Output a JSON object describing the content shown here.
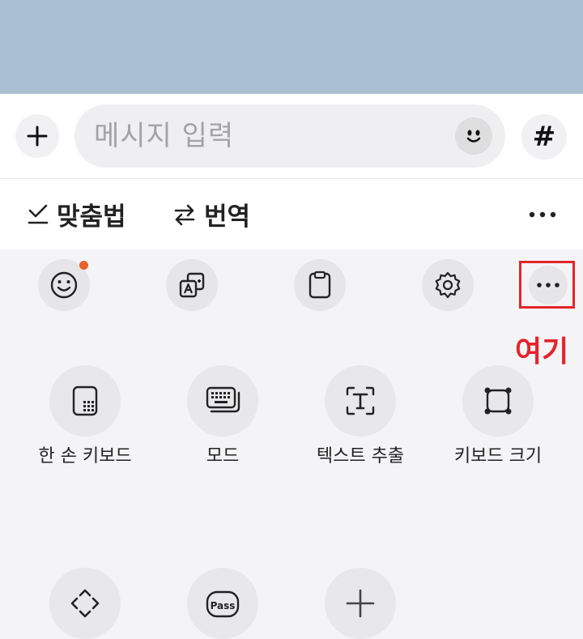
{
  "composer": {
    "placeholder": "메시지 입력",
    "plus_icon": "plus-icon",
    "emoji_icon": "emoji-face-icon",
    "hashtag_label": "#"
  },
  "toolbar": {
    "spellcheck_label": "맞춤법",
    "translate_label": "번역",
    "more_icon": "more-dots-icon"
  },
  "quick_actions": [
    "emoji-icon",
    "translate-icon",
    "clipboard-icon",
    "settings-icon",
    "more-icon"
  ],
  "annotation": {
    "callout": "여기",
    "color": "#e3242b"
  },
  "tiles": [
    {
      "label": "한 손 키보드",
      "icon": "one-hand-keyboard-icon"
    },
    {
      "label": "모드",
      "icon": "keyboard-mode-icon"
    },
    {
      "label": "텍스트 추출",
      "icon": "text-extract-icon"
    },
    {
      "label": "키보드 크기",
      "icon": "keyboard-size-icon"
    },
    {
      "label": "",
      "icon": "move-arrows-icon"
    },
    {
      "label": "",
      "icon": "pass-icon"
    },
    {
      "label": "",
      "icon": "add-icon"
    }
  ],
  "colors": {
    "header": "#a9bfd1",
    "notification_dot": "#e8622a"
  }
}
